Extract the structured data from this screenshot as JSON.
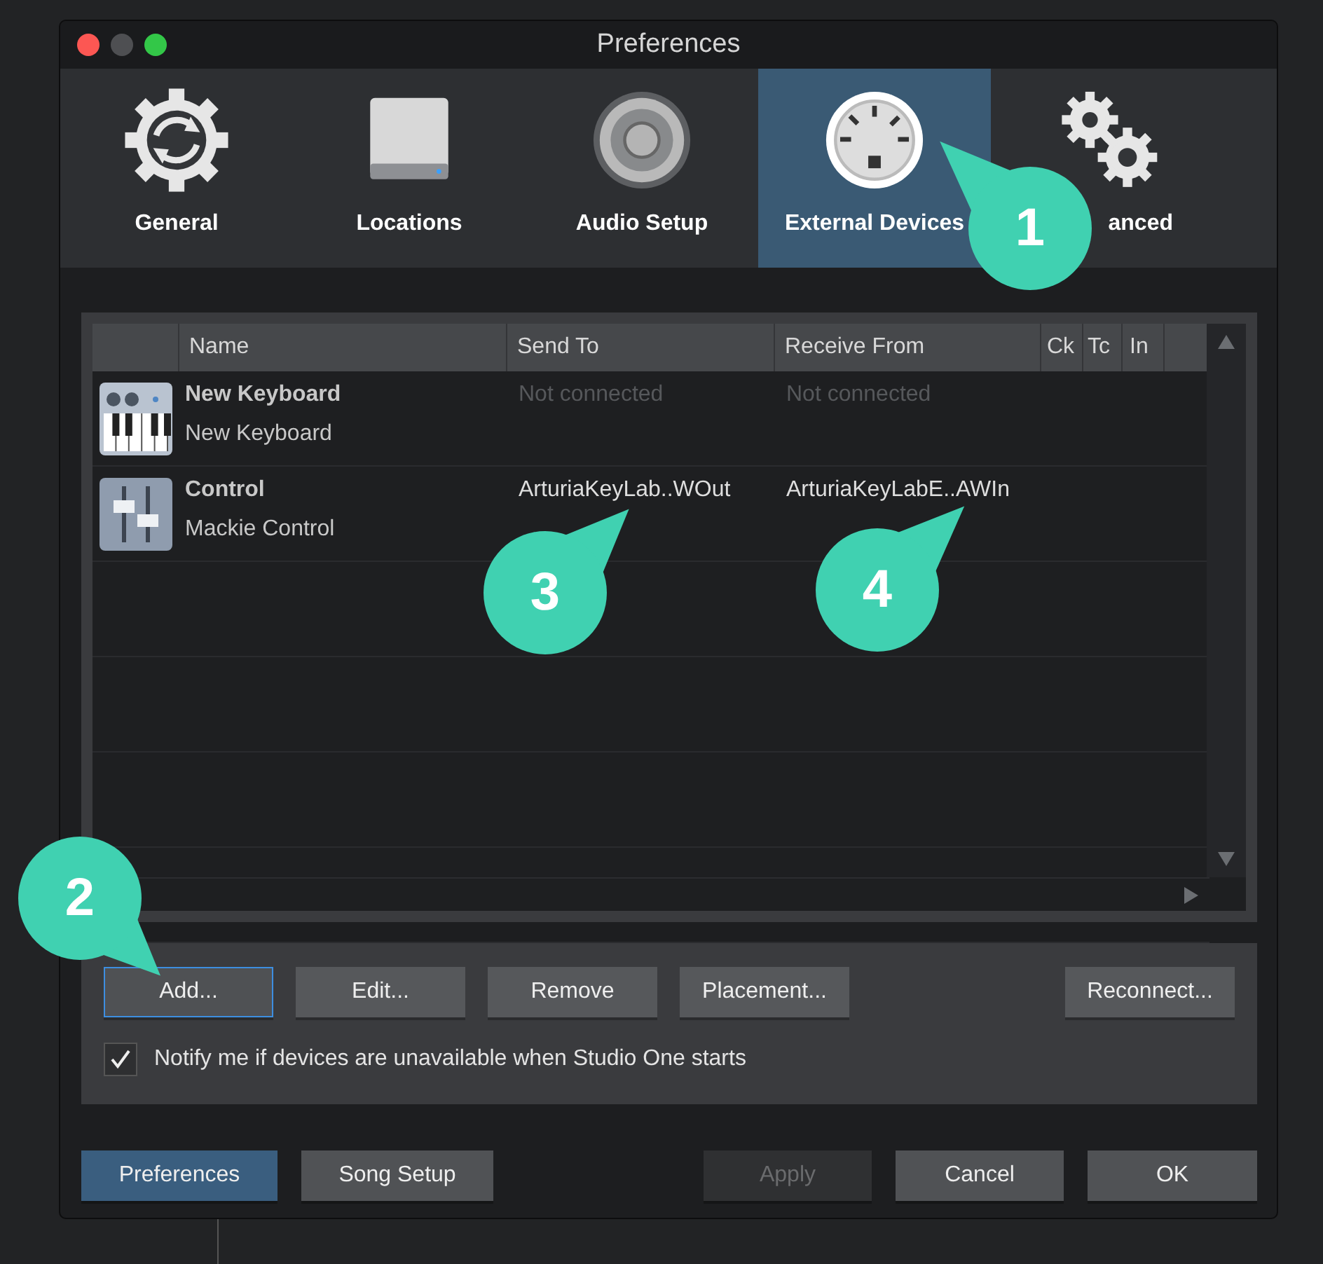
{
  "window": {
    "title": "Preferences"
  },
  "tabs": [
    {
      "label": "General",
      "selected": false
    },
    {
      "label": "Locations",
      "selected": false
    },
    {
      "label": "Audio Setup",
      "selected": false
    },
    {
      "label": "External Devices",
      "selected": true
    },
    {
      "label": "anced",
      "selected": false
    }
  ],
  "table": {
    "columns": [
      "Name",
      "Send To",
      "Receive From",
      "Ck",
      "Tc",
      "In"
    ],
    "rows": [
      {
        "kind": "keyboard",
        "name": "New Keyboard",
        "type": "New Keyboard",
        "send_to": "Not connected",
        "receive_from": "Not connected",
        "connected": false
      },
      {
        "kind": "control",
        "name": "Control",
        "type": "Mackie Control",
        "send_to": "ArturiaKeyLab..WOut",
        "receive_from": "ArturiaKeyLabE..AWIn",
        "connected": true
      }
    ]
  },
  "device_buttons": [
    {
      "label": "Add...",
      "focused": true
    },
    {
      "label": "Edit...",
      "focused": false
    },
    {
      "label": "Remove",
      "focused": false
    },
    {
      "label": "Placement...",
      "focused": false
    },
    {
      "label": "Reconnect...",
      "focused": false
    }
  ],
  "notify": {
    "label": "Notify me if devices are unavailable when Studio One starts",
    "checked": true
  },
  "footer_buttons": [
    {
      "label": "Preferences",
      "selected": true,
      "disabled": false
    },
    {
      "label": "Song Setup",
      "selected": false,
      "disabled": false
    },
    {
      "label": "Apply",
      "selected": false,
      "disabled": true
    },
    {
      "label": "Cancel",
      "selected": false,
      "disabled": false
    },
    {
      "label": "OK",
      "selected": false,
      "disabled": false
    }
  ],
  "callouts": [
    {
      "number": "1"
    },
    {
      "number": "2"
    },
    {
      "number": "3"
    },
    {
      "number": "4"
    }
  ]
}
